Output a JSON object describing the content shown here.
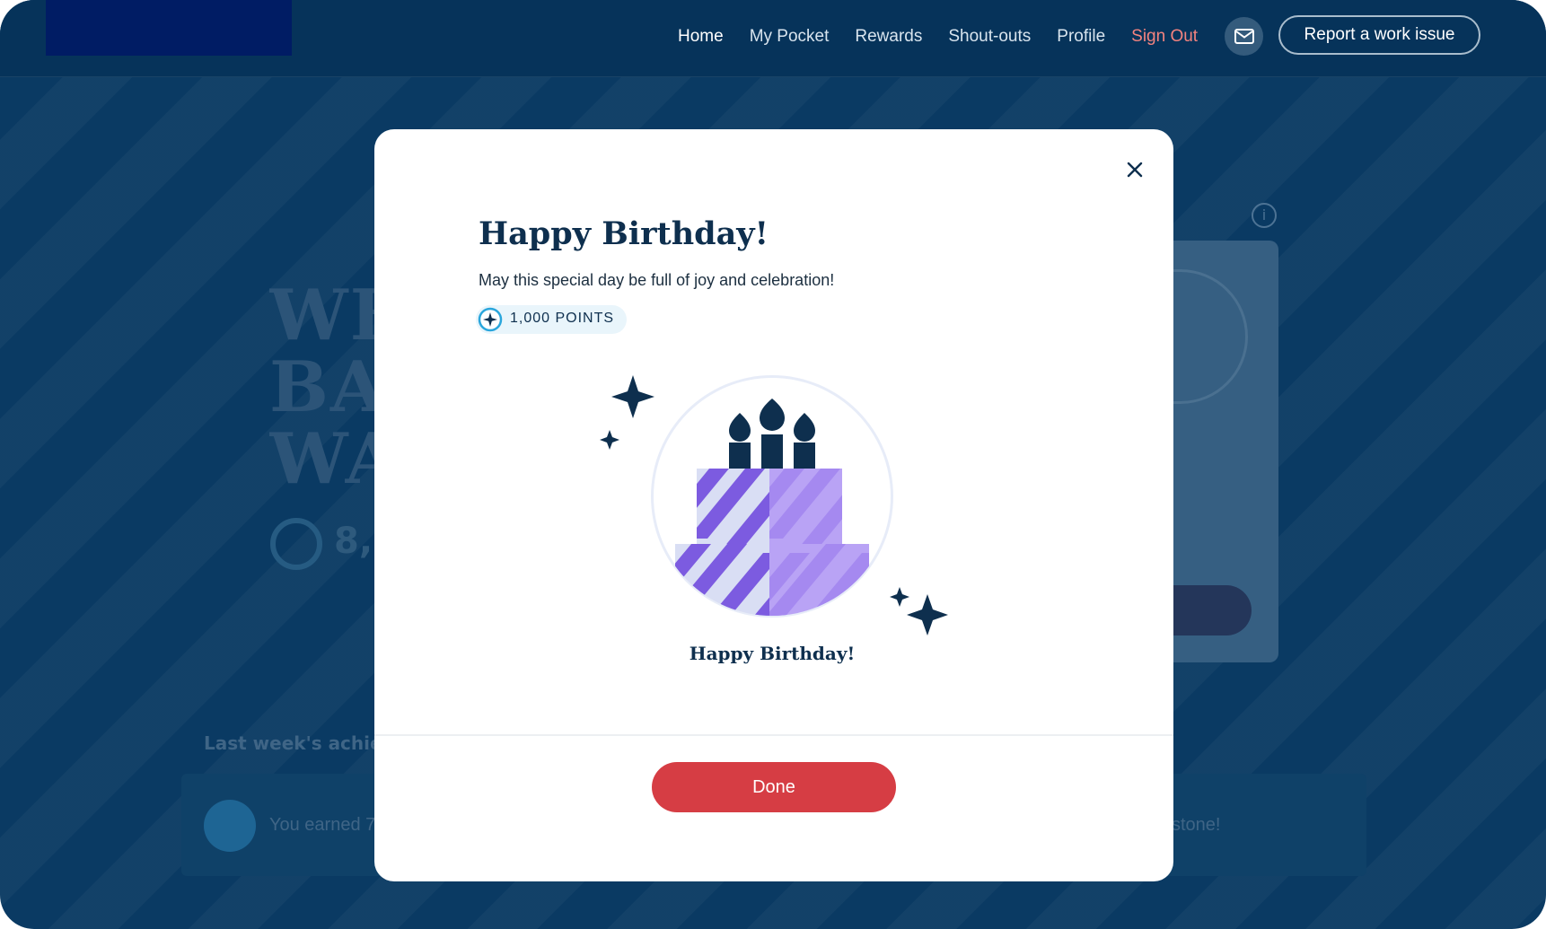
{
  "header": {
    "nav": [
      "Home",
      "My Pocket",
      "Rewards",
      "Shout-outs",
      "Profile",
      "Sign Out"
    ],
    "report_label": "Report a work issue",
    "mail_icon": "mail-icon"
  },
  "background": {
    "hero_lines": [
      "WE",
      "BA",
      "WA"
    ],
    "points_partial": "8,(",
    "achievements_title": "Last week's achie",
    "achievement_text": "You earned 7",
    "achievement_text_right": "stone!"
  },
  "modal": {
    "title": "Happy Birthday!",
    "subtitle": "May this special day be full of joy and celebration!",
    "points": "1,000 POINTS",
    "badge_label": "Happy Birthday!",
    "done_label": "Done",
    "close_icon": "close-icon"
  },
  "colors": {
    "background": "#0a3a63",
    "accent_red": "#d63d44",
    "sign_out": "#f3837f",
    "cake_purple": "#7c5be0",
    "navy": "#0e2f4e"
  }
}
